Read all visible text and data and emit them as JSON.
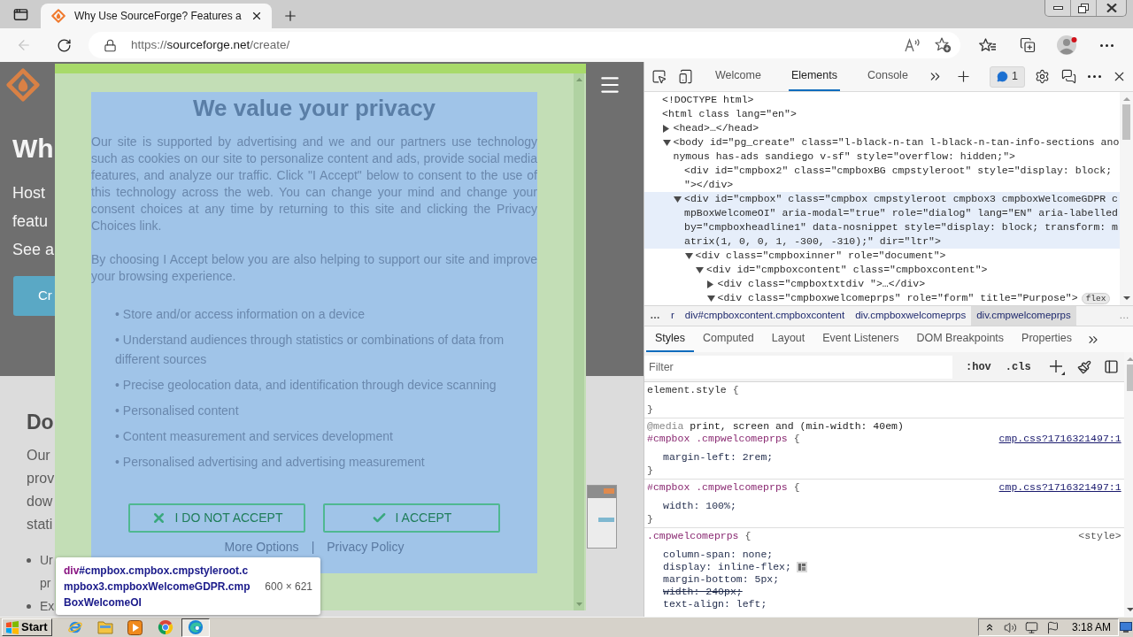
{
  "browser": {
    "tabs": [
      {
        "title": "Why Use SourceForge? Features a",
        "selected": true
      }
    ],
    "back_button": {
      "disabled": true
    },
    "address": {
      "scheme": "https://",
      "host": "sourceforge.net",
      "path": "/create/"
    }
  },
  "page": {
    "hero": {
      "heading": "Wh",
      "lines": [
        "Host",
        "featu",
        "See a"
      ],
      "button": "Cr"
    },
    "section": {
      "heading": "Do",
      "lines": [
        "Our",
        "prov",
        "dow",
        "stati"
      ],
      "bullets": [
        {
          "lines": [
            "Ur",
            "pr"
          ]
        },
        {
          "lines": [
            "Ex"
          ]
        }
      ]
    }
  },
  "consent_dialog": {
    "title": "We value your privacy",
    "paragraphs": [
      "Our site is supported by advertising and we and our partners use technology such as cookies on our site to personalize content and ads, provide social media features, and analyze our traffic. Click \"I Accept\" below to consent to the use of this technology across the web. You can change your mind and change your consent choices at any time by returning to this site and clicking the Privacy Choices link.",
      "By choosing I Accept below you are also helping to support our site and improve your browsing experience."
    ],
    "purposes": [
      "• Store and/or access information on a device",
      "• Understand audiences through statistics or combinations of data from different sources",
      "• Precise geolocation data, and identification through device scanning",
      "• Personalised content",
      "• Content measurement and services development",
      "• Personalised advertising and advertising measurement"
    ],
    "buttons": [
      {
        "label": "I DO NOT ACCEPT",
        "kind": "reject"
      },
      {
        "label": "I ACCEPT",
        "kind": "accept"
      }
    ],
    "links": [
      "More Options",
      "Privacy Policy"
    ],
    "link_separator": "|"
  },
  "inspector_tooltip": {
    "tag": "div",
    "selector": "#cmpbox.cmpbox.cmpstyleroot.cmpbox3.cmpboxWelcomeGDPR.cmpBoxWelcomeOI",
    "size": "600 × 621"
  },
  "devtools": {
    "tabs": [
      {
        "label": "Welcome",
        "selected": false
      },
      {
        "label": "Elements",
        "selected": true
      },
      {
        "label": "Console",
        "selected": false
      }
    ],
    "issues_badge": "1",
    "dom_tree": [
      {
        "text": "<!DOCTYPE html>",
        "hovered": false
      },
      {
        "text": "<html class lang=\"en\">",
        "hovered": false,
        "children": [
          {
            "text": "<head>…</head>",
            "expanded": false,
            "hovered": false
          },
          {
            "text": "<body id=\"pg_create\" class=\"l-black-n-tan l-black-n-tan-info-sections anonymous has-ads sandiego v-sf\" style=\"overflow: hidden;\">",
            "expanded": true,
            "hovered": false,
            "children": [
              {
                "text": "<div id=\"cmpbox2\" class=\"cmpboxBG cmpstyleroot\" style=\"display: block; \"></div>",
                "hovered": false
              },
              {
                "text": "<div id=\"cmpbox\" class=\"cmpbox cmpstyleroot cmpbox3 cmpboxWelcomeGDPR cmpBoxWelcomeOI\" aria-modal=\"true\" role=\"dialog\" lang=\"EN\" aria-labelledby=\"cmpboxheadline1\" data-nosnippet style=\"display: block; transform: matrix(1, 0, 0, 1, -300, -310);\" dir=\"ltr\">",
                "expanded": true,
                "hovered": true,
                "children": [
                  {
                    "text": "<div class=\"cmpboxinner\" role=\"document\">",
                    "expanded": true,
                    "hovered": false,
                    "children": [
                      {
                        "text": "<div id=\"cmpboxcontent\" class=\"cmpboxcontent\">",
                        "expanded": true,
                        "hovered": false,
                        "children": [
                          {
                            "text": "<div class=\"cmpboxtxtdiv \">…</div>",
                            "expanded": false,
                            "hovered": false
                          },
                          {
                            "text": "<div class=\"cmpboxwelcomeprps\" role=\"form\" title=\"Purpose\">",
                            "expanded": true,
                            "hovered": false,
                            "badge": "flex"
                          }
                        ]
                      }
                    ]
                  }
                ]
              }
            ]
          }
        ]
      }
    ],
    "breadcrumbs": {
      "more_left": "…",
      "items": [
        {
          "label": "r",
          "selected": false
        },
        {
          "label": "div#cmpboxcontent.cmpboxcontent",
          "selected": false
        },
        {
          "label": "div.cmpboxwelcomeprps",
          "selected": false
        },
        {
          "label": "div.cmpwelcomeprps",
          "selected": true
        }
      ],
      "more_right": "…"
    },
    "pane_tabs": [
      {
        "label": "Styles",
        "selected": true
      },
      {
        "label": "Computed",
        "selected": false
      },
      {
        "label": "Layout",
        "selected": false
      },
      {
        "label": "Event Listeners",
        "selected": false
      },
      {
        "label": "DOM Breakpoints",
        "selected": false
      },
      {
        "label": "Properties",
        "selected": false
      }
    ],
    "filter": {
      "placeholder": "Filter"
    },
    "toggles": [
      ":hov",
      ".cls"
    ],
    "rules": [
      {
        "kind": "element",
        "selector": "element.style",
        "open": "{",
        "close": "}"
      },
      {
        "kind": "matched",
        "media_keyword": "@media",
        "media_query": "print, screen and (min-width: 40em)",
        "selector": "#cmpbox .cmpwelcomeprps",
        "open": "{",
        "source": "cmp.css?1716321497:1",
        "source_link": true,
        "declarations": [
          {
            "text": "margin-left: 2rem;",
            "overridden": false,
            "editor_icon": false
          }
        ],
        "close": "}"
      },
      {
        "kind": "matched",
        "selector": "#cmpbox .cmpwelcomeprps",
        "open": "{",
        "source": "cmp.css?1716321497:1",
        "source_link": true,
        "declarations": [
          {
            "text": "width: 100%;",
            "overridden": false,
            "editor_icon": false
          }
        ],
        "close": "}"
      },
      {
        "kind": "matched",
        "selector": ".cmpwelcomeprps",
        "open": "{",
        "source": "<style>",
        "source_link": false,
        "declarations": [
          {
            "text": "column-span: none;",
            "overridden": false,
            "editor_icon": false
          },
          {
            "text": "display: inline-flex;",
            "overridden": false,
            "editor_icon": true
          },
          {
            "text": "margin-bottom: 5px;",
            "overridden": false,
            "editor_icon": false
          },
          {
            "text": "width: 240px;",
            "overridden": true,
            "editor_icon": false
          },
          {
            "text": "text-align: left;",
            "overridden": false,
            "editor_icon": false
          }
        ]
      }
    ]
  },
  "taskbar": {
    "start": "Start",
    "apps": [
      {
        "kind": "ie",
        "selected": false
      },
      {
        "kind": "folder",
        "selected": false
      },
      {
        "kind": "media",
        "selected": false
      },
      {
        "kind": "chrome",
        "selected": false
      },
      {
        "kind": "edge",
        "selected": true
      }
    ],
    "clock": "3:18 AM"
  }
}
